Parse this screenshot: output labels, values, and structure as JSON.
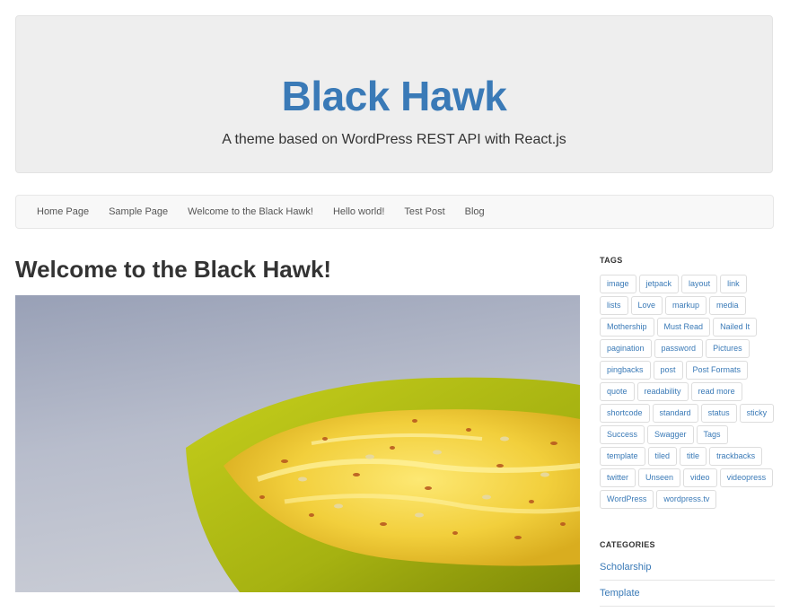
{
  "header": {
    "title": "Black Hawk",
    "description": "A theme based on WordPress REST API with React.js"
  },
  "nav": {
    "items": [
      {
        "label": "Home Page"
      },
      {
        "label": "Sample Page"
      },
      {
        "label": "Welcome to the Black Hawk!"
      },
      {
        "label": "Hello world!"
      },
      {
        "label": "Test Post"
      },
      {
        "label": "Blog"
      }
    ]
  },
  "post": {
    "title": "Welcome to the Black Hawk!",
    "image_subject": "bowl of yellow dessert with nuts and saffron"
  },
  "sidebar": {
    "tags_title": "TAGS",
    "tags": [
      "image",
      "jetpack",
      "layout",
      "link",
      "lists",
      "Love",
      "markup",
      "media",
      "Mothership",
      "Must Read",
      "Nailed It",
      "pagination",
      "password",
      "Pictures",
      "pingbacks",
      "post",
      "Post Formats",
      "quote",
      "readability",
      "read more",
      "shortcode",
      "standard",
      "status",
      "sticky",
      "Success",
      "Swagger",
      "Tags",
      "template",
      "tiled",
      "title",
      "trackbacks",
      "twitter",
      "Unseen",
      "video",
      "videopress",
      "WordPress",
      "wordpress.tv"
    ],
    "categories_title": "CATEGORIES",
    "categories": [
      "Scholarship",
      "Template"
    ]
  },
  "colors": {
    "accent": "#3a7ab7",
    "jumbotron_bg": "#eeeeee",
    "navbar_bg": "#f8f8f8"
  }
}
